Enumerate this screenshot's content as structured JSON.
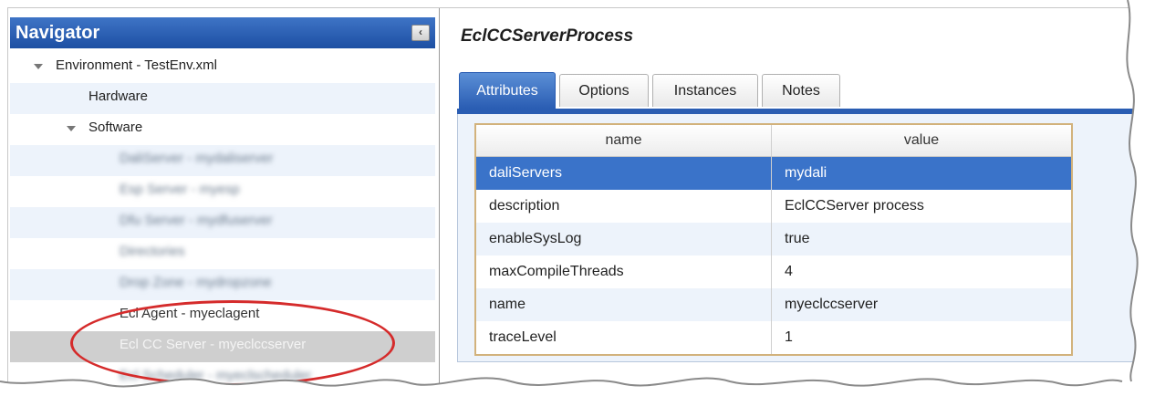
{
  "navigator": {
    "title": "Navigator",
    "collapse_icon": "‹",
    "tree": [
      {
        "label": "Environment - TestEnv.xml",
        "expanded": true,
        "blurred": false
      },
      {
        "label": "Hardware",
        "blurred": false
      },
      {
        "label": "Software",
        "expanded": true,
        "blurred": false
      },
      {
        "label": "DaliServer - mydaliserver",
        "blurred": true
      },
      {
        "label": "Esp Server - myesp",
        "blurred": true
      },
      {
        "label": "Dfu Server - mydfuserver",
        "blurred": true
      },
      {
        "label": "Directories",
        "blurred": true
      },
      {
        "label": "Drop Zone - mydropzone",
        "blurred": true
      },
      {
        "label": "Ecl Agent - myeclagent",
        "blurred": false
      },
      {
        "label": "Ecl CC Server - myeclccserver",
        "selected": true,
        "blurred": false
      },
      {
        "label": "Ecl Scheduler - myeclscheduler",
        "blurred": true
      }
    ]
  },
  "content": {
    "title": "EclCCServerProcess",
    "tabs": [
      {
        "label": "Attributes",
        "active": true
      },
      {
        "label": "Options"
      },
      {
        "label": "Instances"
      },
      {
        "label": "Notes"
      }
    ],
    "grid": {
      "columns": [
        "name",
        "value"
      ],
      "rows": [
        {
          "name": "daliServers",
          "value": "mydali",
          "selected": true
        },
        {
          "name": "description",
          "value": "EclCCServer process"
        },
        {
          "name": "enableSysLog",
          "value": "true"
        },
        {
          "name": "maxCompileThreads",
          "value": "4"
        },
        {
          "name": "name",
          "value": "myeclccserver"
        },
        {
          "name": "traceLevel",
          "value": "1"
        }
      ]
    }
  },
  "colors": {
    "header_blue": "#1d4fa3",
    "selection_blue": "#3a73c9",
    "highlight_ellipse": "#d52b2b",
    "grid_border": "#d2b27c"
  }
}
